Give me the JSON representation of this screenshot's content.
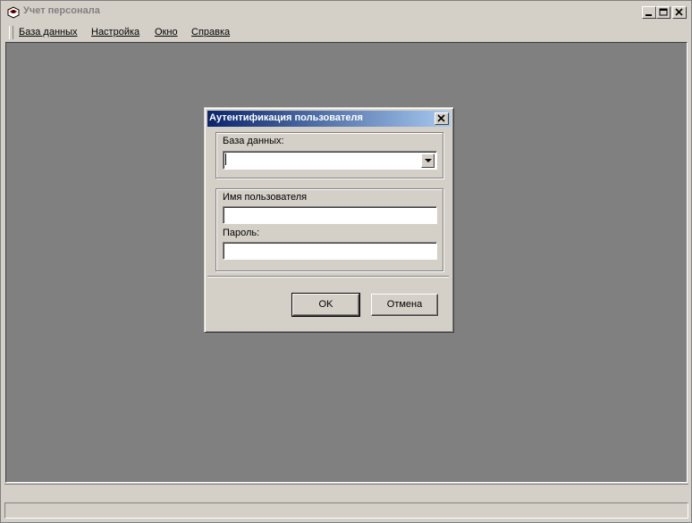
{
  "window": {
    "title": "Учет персонала",
    "icon": "app-icon",
    "controls": [
      "minimize-icon",
      "maximize-icon",
      "close-icon"
    ]
  },
  "menu": {
    "items": [
      {
        "label": "База данных"
      },
      {
        "label": "Настройка"
      },
      {
        "label": "Окно"
      },
      {
        "label": "Справка"
      }
    ]
  },
  "dialog": {
    "title": "Аутентификация пользователя",
    "database_label": "База данных:",
    "database_value": "",
    "username_label": "Имя пользователя",
    "username_value": "",
    "password_label": "Пароль:",
    "password_value": "",
    "ok_label": "OK",
    "cancel_label": "Отмена"
  },
  "colors": {
    "title_active_start": "#0a246a",
    "title_active_end": "#a6caf0",
    "mdi_background": "#808080",
    "face": "#d4d0c8"
  }
}
